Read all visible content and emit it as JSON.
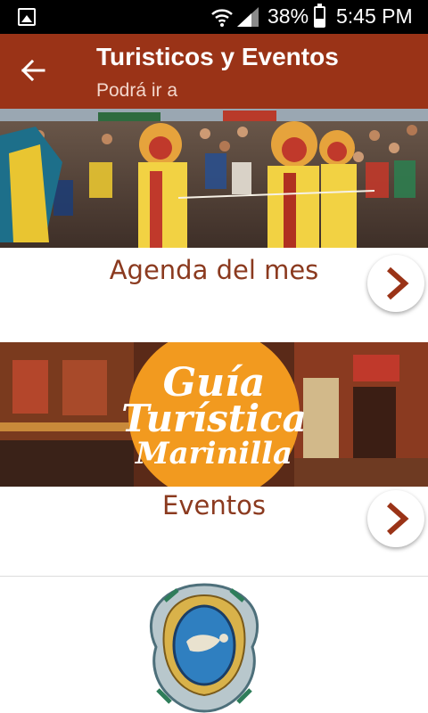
{
  "status_bar": {
    "battery_percent_text": "38%",
    "battery_level": 0.38,
    "time": "5:45 PM"
  },
  "app_bar": {
    "title": "Turisticos y Eventos",
    "subtitle": "Podrá ir a"
  },
  "cards": [
    {
      "label": "Agenda del mes",
      "image": "festival-parade-photo"
    },
    {
      "label": "Eventos",
      "image": "guia-turistica-marinilla-banner"
    }
  ],
  "banner": {
    "line1": "Guía",
    "line2": "Turística",
    "line3": "Marinilla"
  },
  "colors": {
    "app_bar": "#9a3317",
    "label_text": "#8b3a1f",
    "arrow": "#9a3317",
    "banner_circle": "#f29a1f"
  }
}
